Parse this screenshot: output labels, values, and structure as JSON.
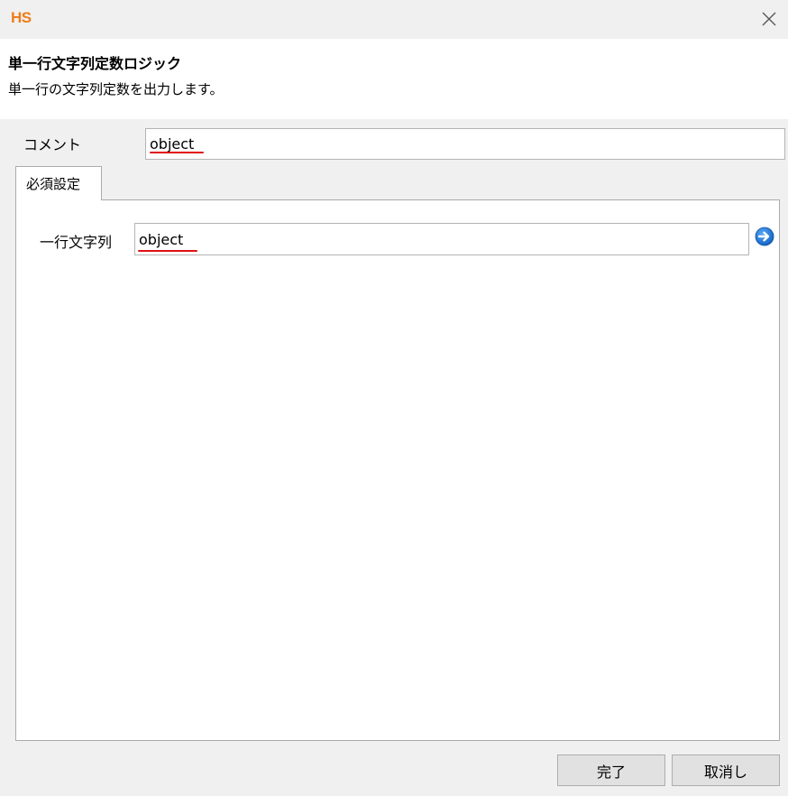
{
  "window": {
    "logo_text": "HS",
    "close_icon": "close-icon"
  },
  "header": {
    "title": "単一行文字列定数ロジック",
    "description": "単一行の文字列定数を出力します。"
  },
  "comment": {
    "label": "コメント",
    "value": "object"
  },
  "tabs": [
    {
      "label": "必須設定",
      "selected": true
    }
  ],
  "required_settings": {
    "field_label": "一行文字列",
    "field_value": "object",
    "action_icon": "arrow-right-circle-icon"
  },
  "buttons": {
    "done_label": "完了",
    "cancel_label": "取消し"
  },
  "colors": {
    "logo": "#ee7d1a",
    "spellcheck_underline": "#e01010",
    "arrow_button": "#1a73d9"
  }
}
